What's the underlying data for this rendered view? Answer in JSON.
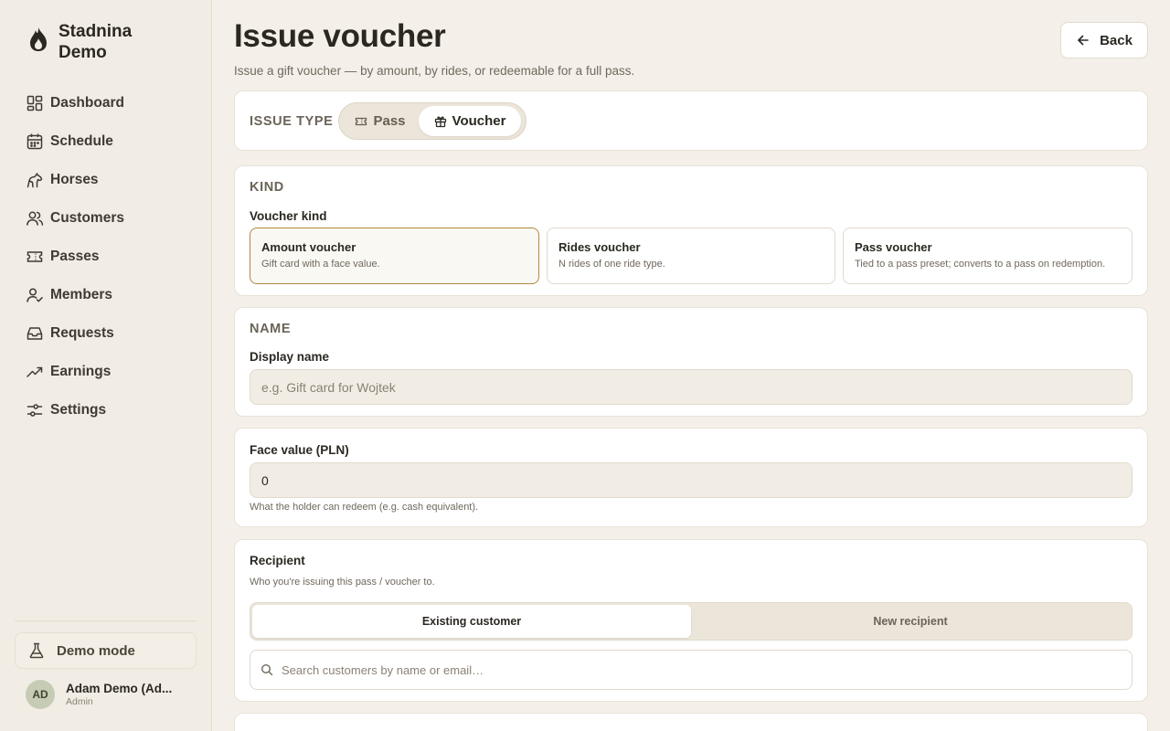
{
  "app": {
    "brand": "Stadnina Demo",
    "brand_icon": "flame-icon"
  },
  "sidebar": {
    "items": [
      {
        "label": "Dashboard",
        "icon": "dashboard-icon"
      },
      {
        "label": "Schedule",
        "icon": "calendar-icon"
      },
      {
        "label": "Horses",
        "icon": "horse-icon"
      },
      {
        "label": "Customers",
        "icon": "users-icon"
      },
      {
        "label": "Passes",
        "icon": "ticket-icon"
      },
      {
        "label": "Members",
        "icon": "member-icon"
      },
      {
        "label": "Requests",
        "icon": "inbox-icon"
      },
      {
        "label": "Earnings",
        "icon": "trend-icon"
      },
      {
        "label": "Settings",
        "icon": "sliders-icon"
      }
    ],
    "demo_mode_label": "Demo mode",
    "user": {
      "initials": "AD",
      "name": "Adam Demo (Ad...",
      "role": "Admin"
    }
  },
  "header": {
    "title": "Issue voucher",
    "subtitle": "Issue a gift voucher — by amount, by rides, or redeemable for a full pass.",
    "back_label": "Back"
  },
  "issue_type": {
    "heading": "ISSUE TYPE",
    "options": [
      "Pass",
      "Voucher"
    ],
    "selected": "Voucher"
  },
  "kind": {
    "heading": "KIND",
    "label": "Voucher kind",
    "options": [
      {
        "title": "Amount voucher",
        "desc": "Gift card with a face value."
      },
      {
        "title": "Rides voucher",
        "desc": "N rides of one ride type."
      },
      {
        "title": "Pass voucher",
        "desc": "Tied to a pass preset; converts to a pass on redemption."
      }
    ],
    "selected": "Amount voucher"
  },
  "name": {
    "heading": "NAME",
    "label": "Display name",
    "placeholder": "e.g. Gift card for Wojtek",
    "value": ""
  },
  "face_value": {
    "label": "Face value (PLN)",
    "value": "0",
    "hint": "What the holder can redeem (e.g. cash equivalent)."
  },
  "recipient": {
    "heading": "Recipient",
    "subtitle": "Who you're issuing this pass / voucher to.",
    "tabs": [
      "Existing customer",
      "New recipient"
    ],
    "selected": "Existing customer",
    "search_placeholder": "Search customers by name or email…"
  },
  "colors": {
    "background": "#f4f0e9",
    "card": "#ffffff",
    "accent_border": "#b08a3e",
    "text": "#2b2721"
  }
}
